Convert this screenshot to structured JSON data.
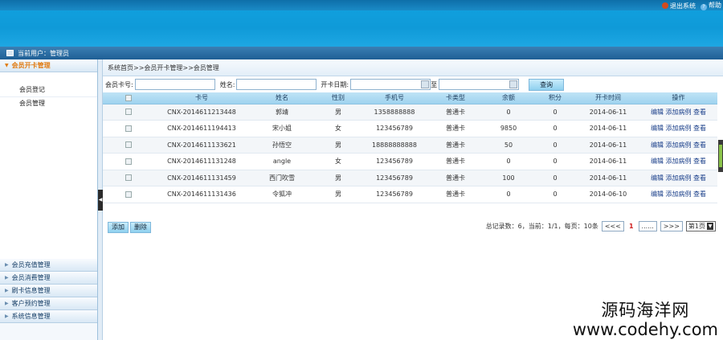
{
  "top": {
    "logout_label": "退出系统",
    "help_label": "帮助"
  },
  "userbar": {
    "current_user": "当前用户：管理员"
  },
  "sidebar": {
    "open_section": {
      "label": "会员开卡管理",
      "items": [
        {
          "label": "会员登记"
        },
        {
          "label": "会员管理"
        }
      ]
    },
    "sections": [
      {
        "label": "会员充值管理"
      },
      {
        "label": "会员消费管理"
      },
      {
        "label": "刷卡信息管理"
      },
      {
        "label": "客户预约管理"
      },
      {
        "label": "系统信息管理"
      }
    ]
  },
  "breadcrumb": "系统首页>>会员开卡管理>>会员管理",
  "search": {
    "card_label": "会员卡号:",
    "name_label": "姓名:",
    "date_label": "开卡日期:",
    "to_label": "至",
    "query_label": "查询",
    "card_value": "",
    "name_value": "",
    "date_from": "",
    "date_to": ""
  },
  "table": {
    "headers": [
      "",
      "卡号",
      "姓名",
      "性别",
      "手机号",
      "卡类型",
      "余额",
      "积分",
      "开卡时间",
      "操作"
    ],
    "rows": [
      {
        "card": "CNX-2014611213448",
        "name": "郭靖",
        "gender": "男",
        "phone": "1358888888",
        "type": "普通卡",
        "balance": "0",
        "points": "0",
        "date": "2014-06-11"
      },
      {
        "card": "CNX-2014611194413",
        "name": "宋小姐",
        "gender": "女",
        "phone": "123456789",
        "type": "普通卡",
        "balance": "9850",
        "points": "0",
        "date": "2014-06-11"
      },
      {
        "card": "CNX-2014611133621",
        "name": "孙悟空",
        "gender": "男",
        "phone": "18888888888",
        "type": "普通卡",
        "balance": "50",
        "points": "0",
        "date": "2014-06-11"
      },
      {
        "card": "CNX-2014611131248",
        "name": "angle",
        "gender": "女",
        "phone": "123456789",
        "type": "普通卡",
        "balance": "0",
        "points": "0",
        "date": "2014-06-11"
      },
      {
        "card": "CNX-2014611131459",
        "name": "西门吹雪",
        "gender": "男",
        "phone": "123456789",
        "type": "普通卡",
        "balance": "100",
        "points": "0",
        "date": "2014-06-11"
      },
      {
        "card": "CNX-2014611131436",
        "name": "令狐冲",
        "gender": "男",
        "phone": "123456789",
        "type": "普通卡",
        "balance": "0",
        "points": "0",
        "date": "2014-06-10"
      }
    ],
    "ops": {
      "edit": "编辑",
      "add_case": "添加病例",
      "view": "查看"
    }
  },
  "actions": {
    "add_label": "添加",
    "delete_label": "删除"
  },
  "pager": {
    "summary": "总记录数：6，当前：1/1，每页：10条",
    "prev": "<<<",
    "current": "1",
    "ellipsis": "......",
    "next": ">>>",
    "page_select": "第1页"
  },
  "watermark": {
    "line1": "源码海洋网",
    "line2": "www.codehy.com"
  }
}
